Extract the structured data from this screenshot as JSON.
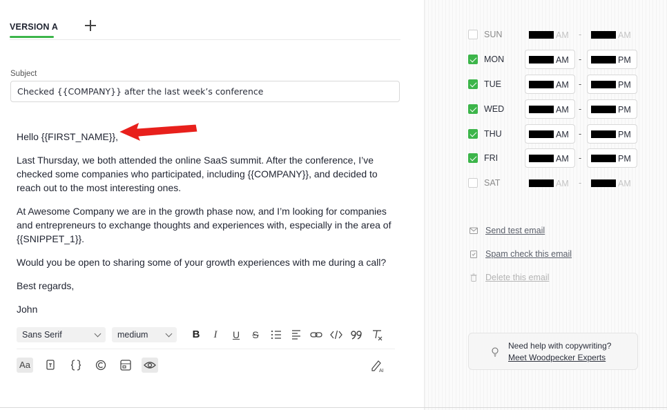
{
  "tabs": {
    "active": "VERSION A",
    "add_icon": "plus-icon"
  },
  "subject": {
    "label": "Subject",
    "value": "Checked {{COMPANY}} after the last week’s conference"
  },
  "email": {
    "greeting": "Hello {{FIRST_NAME}},",
    "p1": "Last Thursday, we both attended the online SaaS summit. After the conference, I’ve checked some companies who participated, including {{COMPANY}}, and decided to reach out to the most interesting ones.",
    "p2": "At Awesome Company we are in the growth phase now, and I’m looking for companies and entrepreneurs to exchange thoughts and experiences with, especially in the area of {{SNIPPET_1}}.",
    "p3": "Would you be open to sharing some of your growth experiences with me during a call?",
    "p4": "Best regards,",
    "p5": "John"
  },
  "toolbar": {
    "font": "Sans Serif",
    "size": "medium",
    "bold": "B",
    "italic": "I",
    "underline": "U",
    "strike": "S"
  },
  "bottom_bar": {
    "aa": "Aa"
  },
  "schedule": [
    {
      "day": "SUN",
      "checked": false,
      "start_suffix": "AM",
      "end_suffix": "AM"
    },
    {
      "day": "MON",
      "checked": true,
      "start_suffix": "AM",
      "end_suffix": "PM"
    },
    {
      "day": "TUE",
      "checked": true,
      "start_suffix": "AM",
      "end_suffix": "PM"
    },
    {
      "day": "WED",
      "checked": true,
      "start_suffix": "AM",
      "end_suffix": "PM"
    },
    {
      "day": "THU",
      "checked": true,
      "start_suffix": "AM",
      "end_suffix": "PM"
    },
    {
      "day": "FRI",
      "checked": true,
      "start_suffix": "AM",
      "end_suffix": "PM"
    },
    {
      "day": "SAT",
      "checked": false,
      "start_suffix": "AM",
      "end_suffix": "AM"
    }
  ],
  "schedule_separator": "-",
  "actions": {
    "send_test": "Send test email",
    "spam_check": "Spam check this email",
    "delete": "Delete this email"
  },
  "help": {
    "title": "Need help with copywriting?",
    "link": "Meet Woodpecker Experts"
  },
  "colors": {
    "accent": "#3cb54a",
    "annotation_arrow": "#e8201c"
  }
}
